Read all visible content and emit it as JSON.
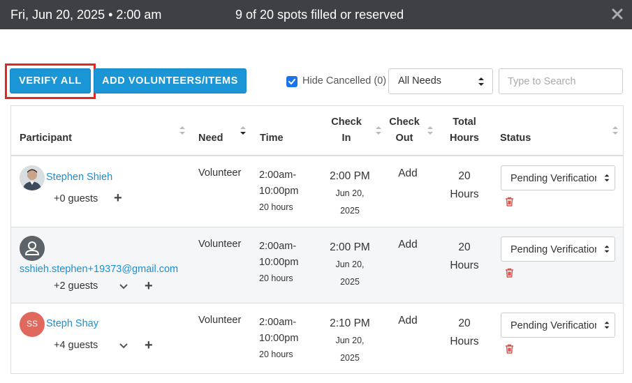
{
  "header": {
    "date": "Fri, Jun 20, 2025 • 2:00 am",
    "spots": "9 of 20 spots filled or reserved",
    "close_icon": "close-icon"
  },
  "toolbar": {
    "verify_all_label": "VERIFY ALL",
    "add_label": "ADD VOLUNTEERS/ITEMS",
    "hide_cancelled_label": "Hide Cancelled (0)",
    "hide_cancelled_checked": true,
    "needs_select_value": "All Needs",
    "search_placeholder": "Type to Search"
  },
  "table": {
    "columns": {
      "participant": "Participant",
      "need": "Need",
      "time": "Time",
      "check_in_1": "Check",
      "check_in_2": "In",
      "check_out_1": "Check",
      "check_out_2": "Out",
      "total_1": "Total",
      "total_2": "Hours",
      "status": "Status"
    },
    "rows": [
      {
        "name": "Stephen Shieh",
        "avatar_type": "photo",
        "guests": "+0 guests",
        "need": "Volunteer",
        "time_1": "2:00am-",
        "time_2": "10:00pm",
        "time_hours": "20 hours",
        "checkin_time": "2:00 PM",
        "checkin_date_1": "Jun 20,",
        "checkin_date_2": "2025",
        "checkout": "Add",
        "total_1": "20",
        "total_2": "Hours",
        "status": "Pending Verification"
      },
      {
        "name": "sshieh.stephen+19373@gmail.com",
        "avatar_type": "default",
        "guests": "+2 guests",
        "need": "Volunteer",
        "time_1": "2:00am-",
        "time_2": "10:00pm",
        "time_hours": "20 hours",
        "checkin_time": "2:00 PM",
        "checkin_date_1": "Jun 20,",
        "checkin_date_2": "2025",
        "checkout": "Add",
        "total_1": "20",
        "total_2": "Hours",
        "status": "Pending Verification"
      },
      {
        "name": "Steph Shay",
        "avatar_type": "initials",
        "avatar_initials": "SS",
        "guests": "+4 guests",
        "need": "Volunteer",
        "time_1": "2:00am-",
        "time_2": "10:00pm",
        "time_hours": "20 hours",
        "checkin_time": "2:10 PM",
        "checkin_date_1": "Jun 20,",
        "checkin_date_2": "2025",
        "checkout": "Add",
        "total_1": "20",
        "total_2": "Hours",
        "status": "Pending Verification"
      }
    ]
  },
  "colors": {
    "accent": "#1a95d5",
    "highlight": "#e02a1f",
    "topbar": "#3d4145",
    "trash": "#d9534f"
  }
}
